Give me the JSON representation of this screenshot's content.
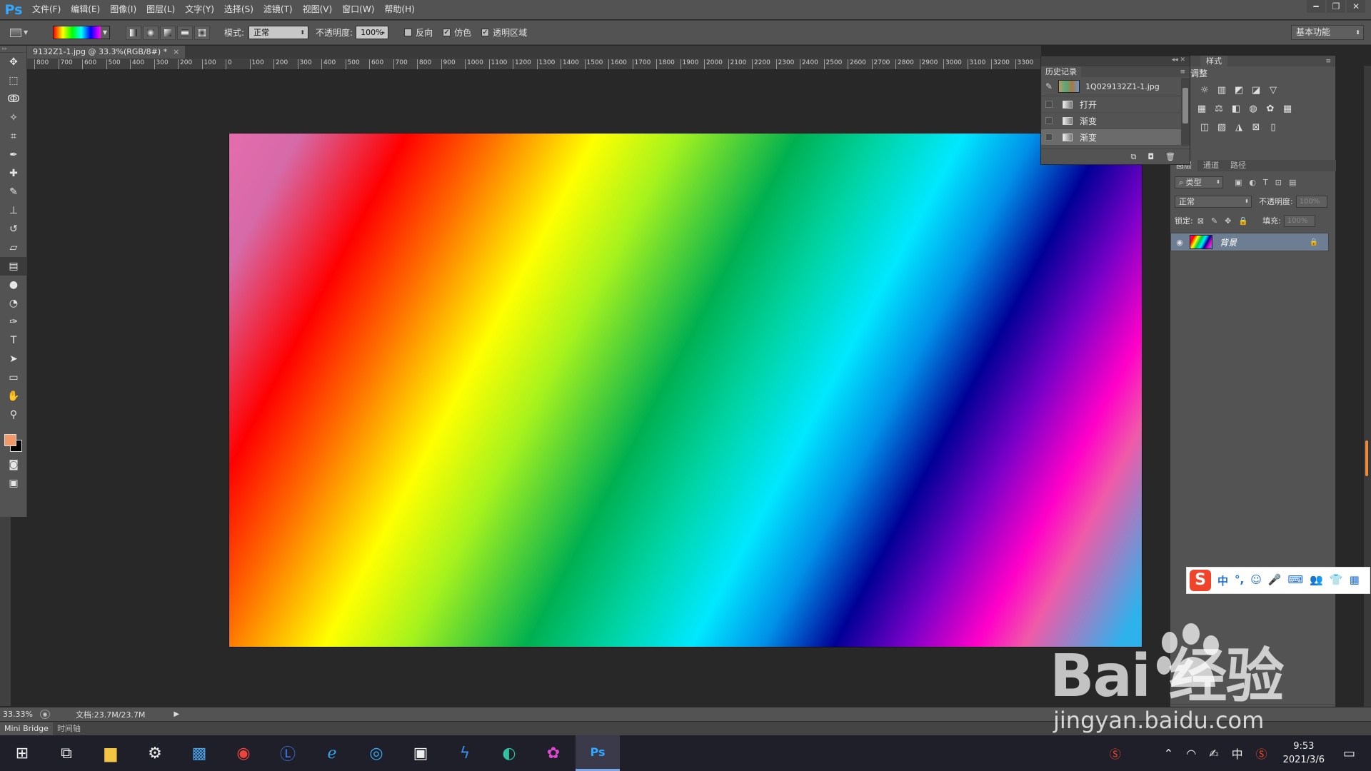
{
  "app": {
    "logo": "Ps"
  },
  "menu": [
    "文件(F)",
    "编辑(E)",
    "图像(I)",
    "图层(L)",
    "文字(Y)",
    "选择(S)",
    "滤镜(T)",
    "视图(V)",
    "窗口(W)",
    "帮助(H)"
  ],
  "window_controls": {
    "minimize": "━",
    "restore": "❐",
    "close": "✕"
  },
  "options": {
    "mode_label": "模式:",
    "mode_value": "正常",
    "opacity_label": "不透明度:",
    "opacity_value": "100%",
    "reverse_label": "反向",
    "reverse_checked": false,
    "dither_label": "仿色",
    "dither_checked": true,
    "transparency_label": "透明区域",
    "transparency_checked": true,
    "workspace": "基本功能"
  },
  "document": {
    "tab_title": "9132Z1-1.jpg @ 33.3%(RGB/8#) *",
    "tab_close": "×"
  },
  "ruler_ticks": [
    "800",
    "700",
    "600",
    "500",
    "400",
    "300",
    "200",
    "100",
    "0",
    "100",
    "200",
    "300",
    "400",
    "500",
    "600",
    "700",
    "800",
    "900",
    "1000",
    "1100",
    "1200",
    "1300",
    "1400",
    "1500",
    "1600",
    "1700",
    "1800",
    "1900",
    "2000",
    "2100",
    "2200",
    "2300",
    "2400",
    "2500",
    "2600",
    "2700",
    "2800",
    "2900",
    "3000",
    "3100",
    "3200",
    "3300"
  ],
  "history": {
    "title": "历史记录",
    "snapshot_name": "1Q029132Z1-1.jpg",
    "steps": [
      {
        "label": "打开",
        "selected": false
      },
      {
        "label": "渐变",
        "selected": false
      },
      {
        "label": "渐变",
        "selected": true
      }
    ]
  },
  "styles_panel": {
    "tab": "样式",
    "adjustments_title": "调整"
  },
  "layers_panel": {
    "tabs": [
      "图层",
      "通道",
      "路径"
    ],
    "filter_value": "类型",
    "blend_mode": "正常",
    "opacity_label": "不透明度:",
    "opacity_value": "100%",
    "lock_label": "锁定:",
    "fill_label": "填充:",
    "fill_value": "100%",
    "layer_name": "背景"
  },
  "status": {
    "zoom": "33.33%",
    "doc_size": "文档:23.7M/23.7M"
  },
  "mini_tabs": [
    "Mini Bridge",
    "时间轴"
  ],
  "ime": {
    "logo": "S",
    "items": [
      "中",
      "°,",
      "☺",
      "🎤",
      "⌨",
      "👥",
      "👕",
      "▦"
    ]
  },
  "watermark": {
    "brand": "Bai  经验",
    "url": "jingyan.baidu.com"
  },
  "taskbar": {
    "tray_lang": "中",
    "time": "9:53",
    "date": "2021/3/6"
  },
  "colors": {
    "accent": "#31a8ff",
    "foreground": "#f09a6a",
    "background": "#000000"
  }
}
